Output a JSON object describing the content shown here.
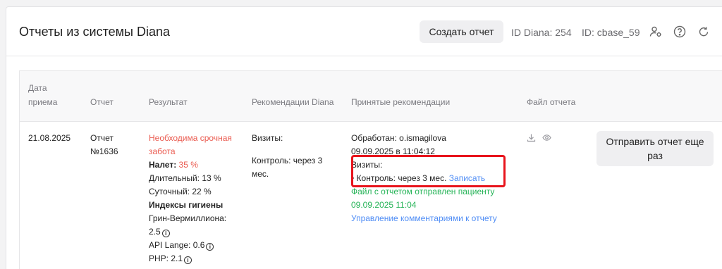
{
  "header": {
    "title": "Отчеты из системы Diana",
    "create_button": "Создать отчет",
    "diana_id": "ID Diana: 254",
    "base_id": "ID: cbase_59"
  },
  "table": {
    "columns": {
      "date_line1": "Дата",
      "date_line2": "приема",
      "report": "Отчет",
      "result": "Результат",
      "recommendations": "Рекомендации Diana",
      "accepted": "Принятые рекомендации",
      "file": "Файл отчета"
    },
    "row": {
      "date": "21.08.2025",
      "report_line1": "Отчет",
      "report_line2": "№1636",
      "result": {
        "urgent_line1": "Необходима срочная",
        "urgent_line2": "забота",
        "plaque_label": "Налет:",
        "plaque_value": "35 %",
        "long": "Длительный: 13 %",
        "daily": "Суточный: 22 %",
        "hygiene_title": "Индексы гигиены",
        "green_vermillion_line1": "Грин-Вермиллиона:",
        "green_vermillion_line2": "2.5",
        "api_lange": "API Lange: 0.6",
        "php": "PHP: 2.1"
      },
      "recommendations": {
        "visits": "Визиты:",
        "control_line1": "Контроль: через 3",
        "control_line2": "мес."
      },
      "accepted": {
        "processed_by": "Обработан: o.ismagilova",
        "processed_at": "09.09.2025 в 11:04:12",
        "visits": "Визиты:",
        "control": "• Контроль: через 3 мес.",
        "book_link": "Записать",
        "file_sent_line1": "Файл с отчетом отправлен пациенту",
        "file_sent_line2": "09.09.2025 11:04",
        "manage_comments": "Управление комментариями к отчету"
      },
      "send_button_line1": "Отправить отчет еще",
      "send_button_line2": "раз"
    }
  },
  "colors": {
    "urgent": "#ea5a4f",
    "success": "#25b357",
    "link": "#4f8df5",
    "highlight": "#e8141c"
  },
  "icons": [
    "user-settings-icon",
    "help-icon",
    "refresh-icon",
    "download-icon",
    "eye-icon",
    "info-icon"
  ]
}
